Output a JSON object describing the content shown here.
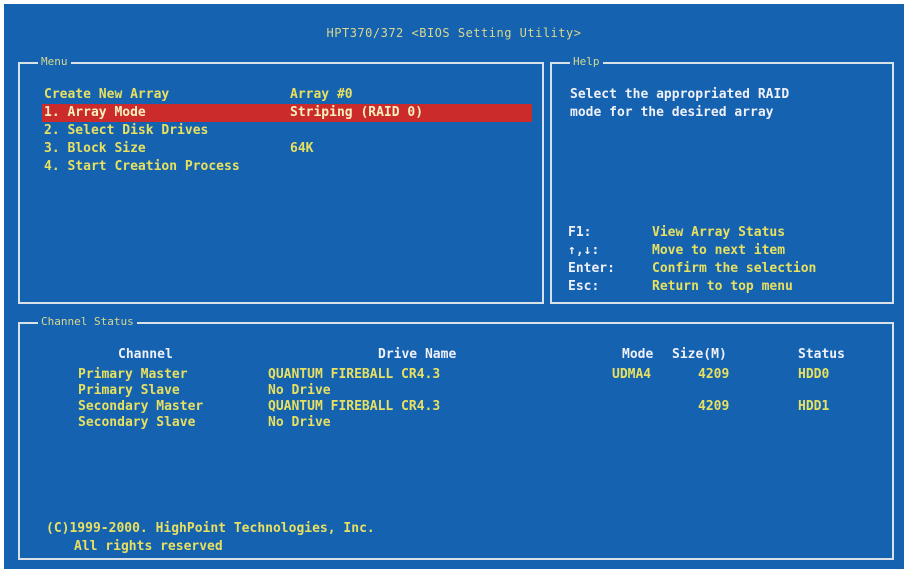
{
  "window": {
    "title": "HPT370/372 <BIOS Setting Utility>"
  },
  "menu": {
    "label": "Menu",
    "header": {
      "left": "Create New Array",
      "right": "Array #0"
    },
    "items": [
      {
        "label": "1. Array Mode",
        "value": "Striping (RAID 0)",
        "selected": true
      },
      {
        "label": "2. Select Disk Drives",
        "value": ""
      },
      {
        "label": "3. Block Size",
        "value": "64K"
      },
      {
        "label": "4. Start Creation Process",
        "value": ""
      }
    ]
  },
  "help": {
    "label": "Help",
    "lines": [
      "Select the appropriated RAID",
      "mode for the desired array"
    ],
    "keys": [
      {
        "key": "F1:",
        "desc": "View Array Status"
      },
      {
        "key": "↑,↓:",
        "desc": "Move to next item"
      },
      {
        "key": "Enter:",
        "desc": "Confirm the selection"
      },
      {
        "key": "Esc:",
        "desc": "Return to top menu"
      }
    ]
  },
  "channel": {
    "label": "Channel Status",
    "headers": {
      "channel": "Channel",
      "drive": "Drive Name",
      "mode": "Mode",
      "size": "Size(M)",
      "status": "Status"
    },
    "rows": [
      {
        "channel": "Primary Master",
        "drive": "QUANTUM FIREBALL CR4.3",
        "mode": "UDMA4",
        "size": "4209",
        "status": "HDD0"
      },
      {
        "channel": "Primary Slave",
        "drive": "No Drive",
        "mode": "",
        "size": "",
        "status": ""
      },
      {
        "channel": "Secondary Master",
        "drive": "QUANTUM FIREBALL CR4.3",
        "mode": "",
        "size": "4209",
        "status": "HDD1"
      },
      {
        "channel": "Secondary Slave",
        "drive": "No Drive",
        "mode": "",
        "size": "",
        "status": ""
      }
    ],
    "copyright": [
      "(C)1999-2000. HighPoint Technologies, Inc.",
      "All rights reserved"
    ]
  },
  "colors": {
    "background": "#1462b0",
    "text": "#e8e060",
    "highlight": "#cc2b2b",
    "border": "#d8e0e8"
  }
}
